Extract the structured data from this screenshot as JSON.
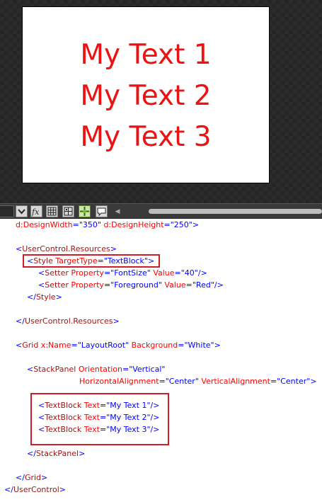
{
  "preview": {
    "texts": [
      "My Text 1",
      "My Text 2",
      "My Text 3"
    ],
    "text_color": "#ee1111",
    "artboard_bg": "#ffffff"
  },
  "toolbar": {
    "icons": [
      "dropdown-icon",
      "fx-icon",
      "grid-icon",
      "grid-alt-icon",
      "snap-icon",
      "annotation-icon",
      "scroll-left-icon"
    ]
  },
  "code": {
    "line_designsize": {
      "a1": "d:DesignWidth",
      "v1": "\"350\"",
      "a2": "d:DesignHeight",
      "v2": "\"250\""
    },
    "line_ucr_open": {
      "el": "UserControl.Resources"
    },
    "line_style_open": {
      "el": "Style",
      "attr": "TargetType",
      "val": "\"TextBlock\""
    },
    "setters": [
      {
        "el": "Setter",
        "a1": "Property",
        "v1": "\"FontSize\"",
        "a2": "Value",
        "v2": "\"40\""
      },
      {
        "el": "Setter",
        "a1": "Property",
        "v1": "\"Foreground\"",
        "a2": "Value",
        "v2": "\"Red\""
      }
    ],
    "line_style_close": {
      "el": "Style"
    },
    "line_ucr_close": {
      "el": "UserControl.Resources"
    },
    "line_grid_open": {
      "el": "Grid",
      "a1": "x:Name",
      "v1": "\"LayoutRoot\"",
      "a2": "Background",
      "v2": "\"White\""
    },
    "line_sp_open": {
      "el": "StackPanel",
      "a1": "Orientation",
      "v1": "\"Vertical\""
    },
    "line_sp_cont": {
      "a1": "HorizontalAlignment",
      "v1": "\"Center\"",
      "a2": "VerticalAlignment",
      "v2": "\"Center\""
    },
    "textblocks": [
      {
        "el": "TextBlock",
        "a": "Text",
        "v": "\"My Text 1\""
      },
      {
        "el": "TextBlock",
        "a": "Text",
        "v": "\"My Text 2\""
      },
      {
        "el": "TextBlock",
        "a": "Text",
        "v": "\"My Text 3\""
      }
    ],
    "line_sp_close": {
      "el": "StackPanel"
    },
    "line_grid_close": {
      "el": "Grid"
    },
    "line_uc_close": {
      "el": "UserControl"
    }
  }
}
